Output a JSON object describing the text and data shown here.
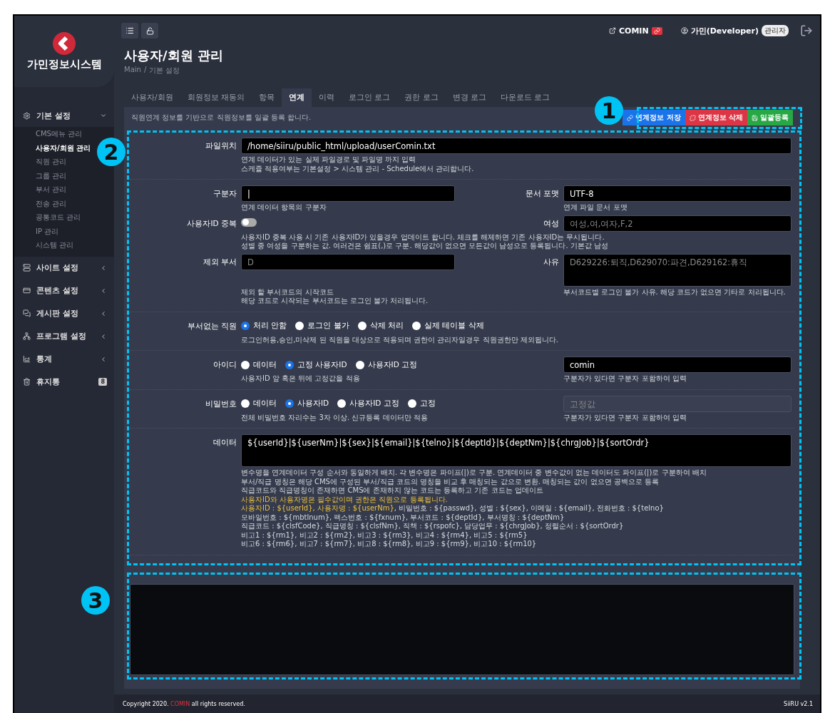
{
  "logo": {
    "title": "가민정보시스템"
  },
  "sidebar": {
    "groups": [
      {
        "label": "기본 설정",
        "expanded": true,
        "children": [
          {
            "label": "CMS메뉴 관리",
            "selected": false
          },
          {
            "label": "사용자/회원 관리",
            "selected": true
          },
          {
            "label": "직원 관리",
            "selected": false
          },
          {
            "label": "그룹 관리",
            "selected": false
          },
          {
            "label": "부서 관리",
            "selected": false
          },
          {
            "label": "전송 관리",
            "selected": false
          },
          {
            "label": "공통코드 관리",
            "selected": false
          },
          {
            "label": "IP 관리",
            "selected": false
          },
          {
            "label": "시스템 관리",
            "selected": false
          }
        ]
      },
      {
        "label": "사이트 설정",
        "expanded": false
      },
      {
        "label": "콘텐츠 설정",
        "expanded": false
      },
      {
        "label": "게시판 설정",
        "expanded": false
      },
      {
        "label": "프로그램 설정",
        "expanded": false
      },
      {
        "label": "통계",
        "expanded": false
      },
      {
        "label": "휴지통",
        "badge": "8"
      }
    ]
  },
  "header": {
    "site": "COMIN",
    "user": "가민(Developer)",
    "role": "관리자"
  },
  "page": {
    "title": "사용자/회원 관리",
    "breadcrumb": [
      "Main",
      "기본 설정"
    ],
    "separator": "/"
  },
  "tabs": [
    {
      "label": "사용자/회원",
      "selected": false
    },
    {
      "label": "회원정보 재동의",
      "selected": false
    },
    {
      "label": "항목",
      "selected": false
    },
    {
      "label": "연계",
      "selected": true
    },
    {
      "label": "이력",
      "selected": false
    },
    {
      "label": "로그인 로그",
      "selected": false
    },
    {
      "label": "권한 로그",
      "selected": false
    },
    {
      "label": "변경 로그",
      "selected": false
    },
    {
      "label": "다운로드 로그",
      "selected": false
    }
  ],
  "description": "직원연계 정보를 기반으로 직원정보를 일괄 등록 합니다.",
  "actions": [
    {
      "label": "연계정보 저장",
      "kind": "save"
    },
    {
      "label": "연계정보 삭제",
      "kind": "delete"
    },
    {
      "label": "일괄등록",
      "kind": "register"
    }
  ],
  "sections": [
    [
      {
        "label": "파일위치",
        "control": {
          "kind": "input",
          "value": "/home/siiru/public_html/upload/userComin.txt"
        },
        "help": [
          "연계 데이터가 있는 실제 파일경로 및 파일명 까지 입력",
          "스케쥴 적용여부는 기본설정 > 시스템 관리 - Schedule에서 관리합니다."
        ]
      }
    ],
    [
      {
        "label": "구분자",
        "control": {
          "kind": "input",
          "value": "|"
        },
        "help": [
          "연계 데이터 항목의 구분자"
        ],
        "side": {
          "label": "문서 포맷",
          "control": {
            "kind": "input",
            "value": "UTF-8"
          },
          "help": [
            "연계 파일 문서 포맷"
          ]
        }
      },
      {
        "label": "사용자ID 중복",
        "control": {
          "kind": "toggle",
          "on": false
        },
        "help": [
          "사용자ID 중복 사용 시 기존 사용자ID가 있을경우 업데이트 합니다. 체크를 해제하면 기존 사용자ID는 무시됩니다.",
          "성별 중 여성을 구분하는 값. 여러건은 쉼표(,)로 구분. 해당값이 없으면 모든값이 남성으로 등록됩니다. 기본값 남성"
        ],
        "side": {
          "label": "여성",
          "control": {
            "kind": "input",
            "placeholder": "여성,여,여자,F,2"
          }
        }
      },
      {
        "label": "제외 부서",
        "control": {
          "kind": "input",
          "placeholder": "D"
        },
        "help": [
          "제외 할 부서코드의 시작코드",
          "해당 코드로 시작되는 부서코드는 로그인 불가 처리됩니다."
        ],
        "side": {
          "label": "사유",
          "control": {
            "kind": "textarea",
            "placeholder": "D629226:퇴직,D629070:파견,D629162:휴직"
          },
          "help": [
            "부서코드별 로그인 불가 사유. 해당 코드가 없으면 기타로 처리됩니다."
          ]
        }
      }
    ],
    [
      {
        "label": "부서없는 직원",
        "control": {
          "kind": "radio",
          "options": [
            {
              "label": "처리 안함",
              "selected": true
            },
            {
              "label": "로그인 불가",
              "selected": false
            },
            {
              "label": "삭제 처리",
              "selected": false
            },
            {
              "label": "실제 테이블 삭제",
              "selected": false
            }
          ]
        },
        "help": [
          "로그인허용,승인,미삭제 된 직원을 대상으로 적용되며 권한이 관리자일경우 직원권한만 제외됩니다."
        ]
      }
    ],
    [
      {
        "label": "아이디",
        "control": {
          "kind": "radio",
          "options": [
            {
              "label": "데이터",
              "selected": false
            },
            {
              "label": "고정 사용자ID",
              "selected": true
            },
            {
              "label": "사용자ID 고정",
              "selected": false
            }
          ]
        },
        "help": [
          "사용자ID 앞 혹은 뒤에 고정값을 적용"
        ],
        "side": {
          "control": {
            "kind": "input",
            "value": "comin"
          },
          "help": [
            "구분자가 있다면 구분자 포함하여 입력"
          ]
        }
      }
    ],
    [
      {
        "label": "비밀번호",
        "control": {
          "kind": "radio",
          "options": [
            {
              "label": "데이터",
              "selected": false
            },
            {
              "label": "사용자ID",
              "selected": true
            },
            {
              "label": "사용자ID 고정",
              "selected": false
            },
            {
              "label": "고정",
              "selected": false
            }
          ]
        },
        "help": [
          "전체 비밀번호 자리수는 3자 이상. 신규등록 데이터만 적용"
        ],
        "side": {
          "control": {
            "kind": "input",
            "placeholder": "고정값",
            "disabled": true
          },
          "help": [
            "구분자가 있다면 구분자 포함하여 입력"
          ]
        }
      }
    ],
    [
      {
        "label": "데이터",
        "control": {
          "kind": "textarea",
          "value": "${userId}|${userNm}|${sex}|${email}|${telno}|${deptId}|${deptNm}|${chrgJob}|${sortOrdr}"
        },
        "notes": [
          [
            {
              "text": "변수명을 연계데이터 구성 순서와 동일하게 배치. 각 변수명은 파이프(|)로 구분. 연계데이터 중 변수값이 없는 데이터도 파이프(|)로 구분하여 배치",
              "highlight": false
            }
          ],
          [
            {
              "text": "부서/직급 명칭은 해당 CMS에 구성된 부서/직급 코드의 명칭을 비교 후 매칭되는 값으로 변환. 매칭되는 값이 없으면 공백으로 등록",
              "highlight": false
            }
          ],
          [
            {
              "text": "직급코드와 직급명칭이 존재하면 CMS에 존재하지 않는 코드는 등록하고 기존 코드는 업데이트",
              "highlight": false
            }
          ],
          [
            {
              "text": "사용자ID와 사용자명은 필수값이며 권한은 직원으로 등록됩니다.",
              "highlight": true
            }
          ],
          [
            {
              "text": "사용자ID : ${userId}, 사용자명 : ${userNm}",
              "highlight": true
            },
            {
              "text": ", 비밀번호 : ${passwd}, 성별 : ${sex}, 이메일 : ${email}, 전화번호 : ${telno}",
              "highlight": false
            }
          ],
          [
            {
              "text": "모바일번호 : ${mbtlnum}, 팩스번호 : ${fxnum}, 부서코드 : ${deptId}, 부서명칭 : ${deptNm}",
              "highlight": false
            }
          ],
          [
            {
              "text": "직급코드 : ${clsfCode}, 직급명칭 : ${clsfNm}, 직책 : ${rspofc}, 담당업무 : ${chrgJob}, 정렬순서 : ${sortOrdr}",
              "highlight": false
            }
          ],
          [
            {
              "text": "비고1 : ${rm1}, 비고2 : ${rm2}, 비고3 : ${rm3}, 비고4 : ${rm4}, 비고5 : ${rm5}",
              "highlight": false
            }
          ],
          [
            {
              "text": "비고6 : ${rm6}, 비고7 : ${rm7}, 비고8 : ${rm8}, 비고9 : ${rm9}, 비고10 : ${rm10}",
              "highlight": false
            }
          ]
        ]
      }
    ]
  ],
  "callouts": [
    "1",
    "2",
    "3"
  ],
  "footer": {
    "copyright": [
      "Copyright 2020. ",
      "COMIN",
      " all rights reserved."
    ],
    "version": "SiiRU v2.1"
  }
}
